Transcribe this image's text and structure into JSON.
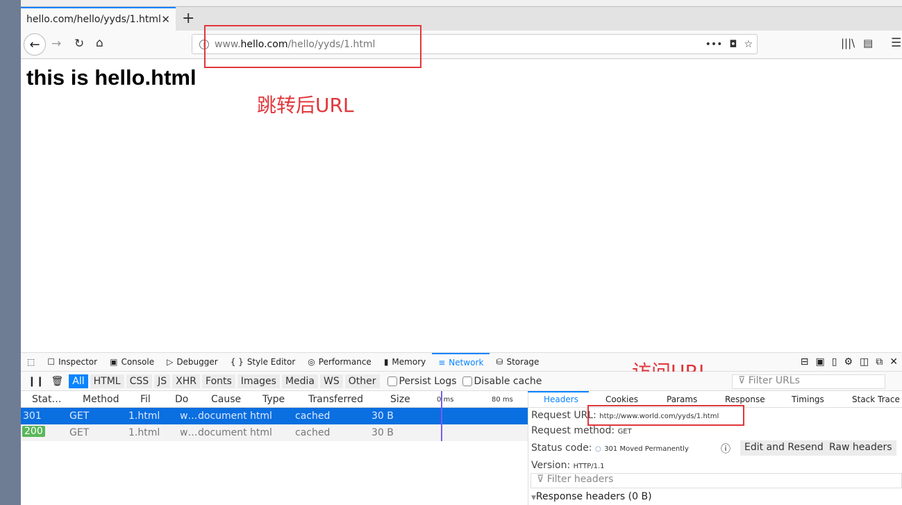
{
  "browser": {
    "tab_title": "hello.com/hello/yyds/1.html",
    "url_prefix": "www.",
    "url_domain": "hello.com",
    "url_path": "/hello/yyds/1.html"
  },
  "page": {
    "heading": "this is hello.html"
  },
  "annotations": {
    "after_redirect": "跳转后URL",
    "visited": "访问URL"
  },
  "devtools": {
    "tabs": [
      "Inspector",
      "Console",
      "Debugger",
      "Style Editor",
      "Performance",
      "Memory",
      "Network",
      "Storage"
    ],
    "active_tab": "Network",
    "filters": [
      "All",
      "HTML",
      "CSS",
      "JS",
      "XHR",
      "Fonts",
      "Images",
      "Media",
      "WS",
      "Other"
    ],
    "persist_logs": "Persist Logs",
    "disable_cache": "Disable cache",
    "filter_placeholder": "Filter URLs",
    "columns": [
      "Stat…",
      "Method",
      "Fil",
      "Do",
      "Cause",
      "Type",
      "Transferred",
      "Size",
      "0 ms",
      "80 ms"
    ],
    "rows": [
      {
        "status": "301",
        "method": "GET",
        "file": "1.html",
        "domain": "w…",
        "cause": "document",
        "type": "html",
        "transferred": "cached",
        "size": "30 B"
      },
      {
        "status": "200",
        "method": "GET",
        "file": "1.html",
        "domain": "w…",
        "cause": "document",
        "type": "html",
        "transferred": "cached",
        "size": "30 B"
      }
    ],
    "detail_tabs": [
      "Headers",
      "Cookies",
      "Params",
      "Response",
      "Timings",
      "Stack Trace"
    ],
    "request_url_label": "Request URL:",
    "request_url": "http://www.world.com/yyds/1.html",
    "request_method_label": "Request method:",
    "request_method": "GET",
    "status_code_label": "Status code:",
    "status_code": "301 Moved Permanently",
    "version_label": "Version:",
    "version": "HTTP/1.1",
    "edit_resend": "Edit and Resend",
    "raw_headers": "Raw headers",
    "filter_headers": "Filter headers",
    "response_headers": "Response headers (0 B)"
  },
  "colors": {
    "accent": "#0a84ff",
    "annotation": "#e0363b",
    "selected_row": "#0a6fe0",
    "status_ok": "#5bb75b"
  }
}
